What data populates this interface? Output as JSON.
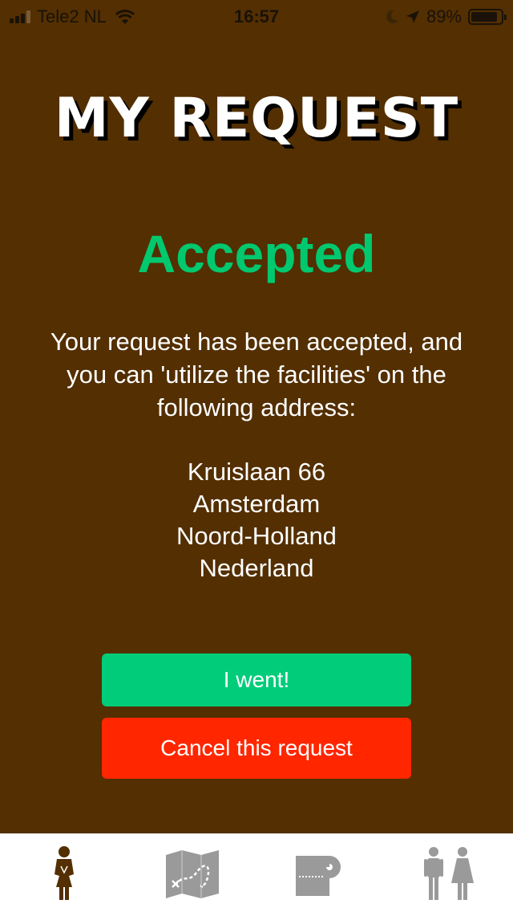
{
  "status_bar": {
    "carrier": "Tele2 NL",
    "time": "16:57",
    "battery": "89%",
    "battery_level": 0.89
  },
  "page": {
    "title": "MY REQUEST",
    "status": "Accepted",
    "message": "Your request has been accepted, and you can 'utilize the facilities' on the following address:",
    "address": {
      "street": "Kruislaan 66",
      "city": "Amsterdam",
      "province": "Noord-Holland",
      "country": "Nederland"
    }
  },
  "actions": {
    "went_label": "I went!",
    "cancel_label": "Cancel this request"
  },
  "tabbar": {
    "tabs": [
      {
        "icon": "waiting-person-icon",
        "active": true
      },
      {
        "icon": "treasure-map-icon",
        "active": false
      },
      {
        "icon": "toilet-paper-icon",
        "active": false
      },
      {
        "icon": "restroom-people-icon",
        "active": false
      }
    ]
  },
  "colors": {
    "background": "#532f01",
    "accepted": "#00c86f",
    "went_button": "#00cc7a",
    "cancel_button": "#ff2600",
    "tab_active": "#532f01",
    "tab_inactive": "#9a9a9a"
  }
}
